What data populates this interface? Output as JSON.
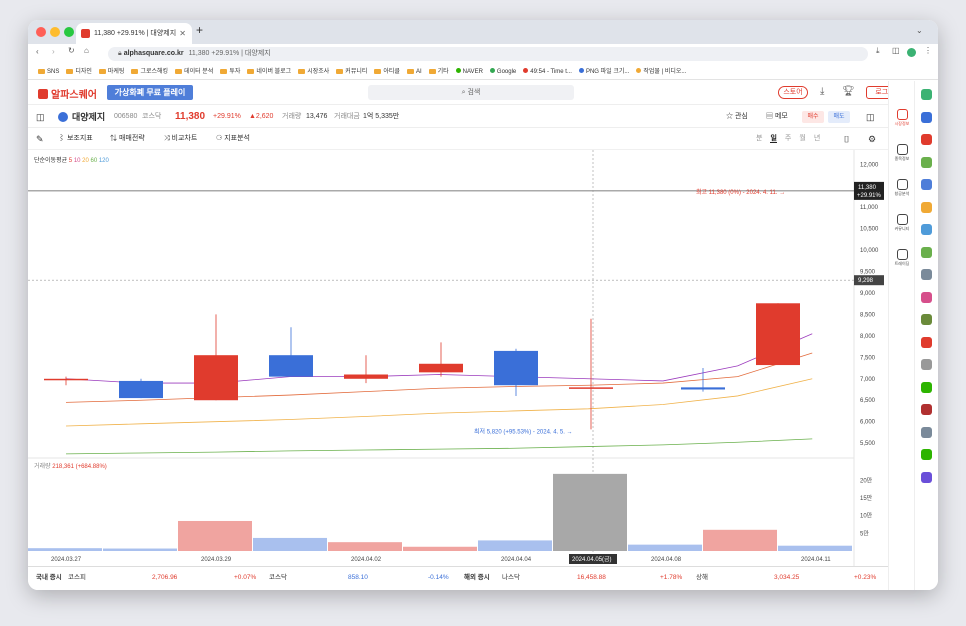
{
  "browser": {
    "tab_title": "11,380 +29.91% | 대양제지",
    "url_host": "alphasquare.co.kr",
    "url_rest": "11,380 +29.91% | 대양제지",
    "bookmarks": [
      "SNS",
      "디자인",
      "마케팅",
      "그로스해킹",
      "데이터 분석",
      "투자",
      "네이버 블로그",
      "시장조사",
      "커뮤니티",
      "아티클",
      "AI",
      "기타",
      "NAVER",
      "Google",
      "49:54 - Time t...",
      "PNG 파일 크기...",
      "작업물 | 비디오..."
    ]
  },
  "header": {
    "logo": "알파스퀘어",
    "promo": "가상화폐 무료 플레이",
    "search_placeholder": "검색",
    "store": "스토어",
    "login": "로그인"
  },
  "stock": {
    "name": "대양제지",
    "code": "006580",
    "market": "코스닥",
    "price": "11,380",
    "change_pct": "+29.91%",
    "change": "▲2,620",
    "volume_label": "거래량",
    "volume": "13,476",
    "amount_label": "거래대금",
    "amount": "1억 5,335만",
    "watch": "관심",
    "memo": "메모",
    "buy": "매수",
    "sell": "매도"
  },
  "tools": {
    "draw": "",
    "aux": "보조지표",
    "strategy": "매매전략",
    "compare": "비교차트",
    "analysis": "지표분석",
    "periods": [
      "분",
      "일",
      "주",
      "월",
      "년"
    ],
    "active_period": "일"
  },
  "chart_data": {
    "type": "candlestick",
    "ma_label": "단순이동평균",
    "ma_periods": [
      {
        "p": "5",
        "color": "#e03b2d"
      },
      {
        "p": "10",
        "color": "#d64f8b"
      },
      {
        "p": "20",
        "color": "#f0a935"
      },
      {
        "p": "60",
        "color": "#6ab04c"
      },
      {
        "p": "120",
        "color": "#4f9bd9"
      }
    ],
    "price_ticks": [
      "12,000",
      "11,500",
      "11,000",
      "10,500",
      "10,000",
      "9,500",
      "9,000",
      "8,500",
      "8,000",
      "7,500",
      "7,000",
      "6,500",
      "6,000",
      "5,500"
    ],
    "ylim": [
      5200,
      12100
    ],
    "candles": [
      {
        "o": 7000,
        "h": 7050,
        "l": 6850,
        "c": 7000
      },
      {
        "o": 6950,
        "h": 7000,
        "l": 6550,
        "c": 6550
      },
      {
        "o": 6500,
        "h": 8500,
        "l": 6500,
        "c": 7550
      },
      {
        "o": 7550,
        "h": 8200,
        "l": 7050,
        "c": 7050
      },
      {
        "o": 7000,
        "h": 7550,
        "l": 6900,
        "c": 7100
      },
      {
        "o": 7150,
        "h": 7850,
        "l": 7050,
        "c": 7350
      },
      {
        "o": 7650,
        "h": 7700,
        "l": 6600,
        "c": 6850
      },
      {
        "o": 6800,
        "h": 8400,
        "l": 5820,
        "c": 6800
      },
      {
        "o": 6800,
        "h": 7250,
        "l": 6700,
        "c": 6750
      },
      {
        "o": 7320,
        "h": 8760,
        "l": 7320,
        "c": 8760
      }
    ],
    "ma_lines": [
      {
        "color": "#9b3bbd",
        "values": [
          7000,
          6900,
          6900,
          7050,
          7050,
          7100,
          7050,
          7000,
          6950,
          7300,
          8050
        ]
      },
      {
        "color": "#e26a3b",
        "values": [
          6450,
          6500,
          6560,
          6620,
          6700,
          6780,
          6820,
          6850,
          6900,
          7050,
          7600
        ]
      },
      {
        "color": "#f0b24a",
        "values": [
          5900,
          5950,
          6000,
          6050,
          6120,
          6200,
          6250,
          6300,
          6400,
          6600,
          7000
        ]
      },
      {
        "color": "#6ab04c",
        "values": [
          5250,
          5270,
          5290,
          5320,
          5340,
          5360,
          5380,
          5420,
          5460,
          5520,
          5600
        ]
      }
    ],
    "current_price": "11,380",
    "current_change": "+29.91%",
    "cross_price": "9,298",
    "high_note": "최고 11,380 (0%) - 2024. 4. 11.",
    "low_note": "최저 5,820 (+95.53%) - 2024. 4. 5.",
    "volume_label": "거래량",
    "volume_value": "218,361 (+684.88%)",
    "volume_ticks": [
      "20만",
      "15만",
      "10만",
      "5만"
    ],
    "volumes": [
      {
        "v": 8000,
        "up": false
      },
      {
        "v": 7000,
        "up": false
      },
      {
        "v": 85000,
        "up": true
      },
      {
        "v": 37000,
        "up": false
      },
      {
        "v": 25000,
        "up": true
      },
      {
        "v": 12000,
        "up": true
      },
      {
        "v": 30000,
        "up": false
      },
      {
        "v": 218361,
        "up": false,
        "highlight": true
      },
      {
        "v": 18000,
        "up": false
      },
      {
        "v": 60000,
        "up": true
      },
      {
        "v": 15000,
        "up": false
      }
    ],
    "dates": [
      "2024.03.27",
      "2024.03.29",
      "2024.04.02",
      "2024.04.04",
      "2024.04.05(금)",
      "2024.04.08",
      "2024.04.11"
    ]
  },
  "footer": {
    "domestic": "국내 증시",
    "items": [
      {
        "name": "코스피",
        "value": "2,706.96",
        "chg": "+0.07%",
        "up": true
      },
      {
        "name": "코스닥",
        "value": "858.10",
        "chg": "-0.14%",
        "up": false
      }
    ],
    "overseas": "해외 증시",
    "items2": [
      {
        "name": "나스닥",
        "value": "16,458.88",
        "chg": "+1.78%",
        "up": true
      },
      {
        "name": "상해",
        "value": "3,034.25",
        "chg": "+0.23%",
        "up": true
      }
    ]
  },
  "sidebar": [
    "시장정보",
    "종목정보",
    "창공분석",
    "커뮤니티",
    "트레이딩"
  ]
}
